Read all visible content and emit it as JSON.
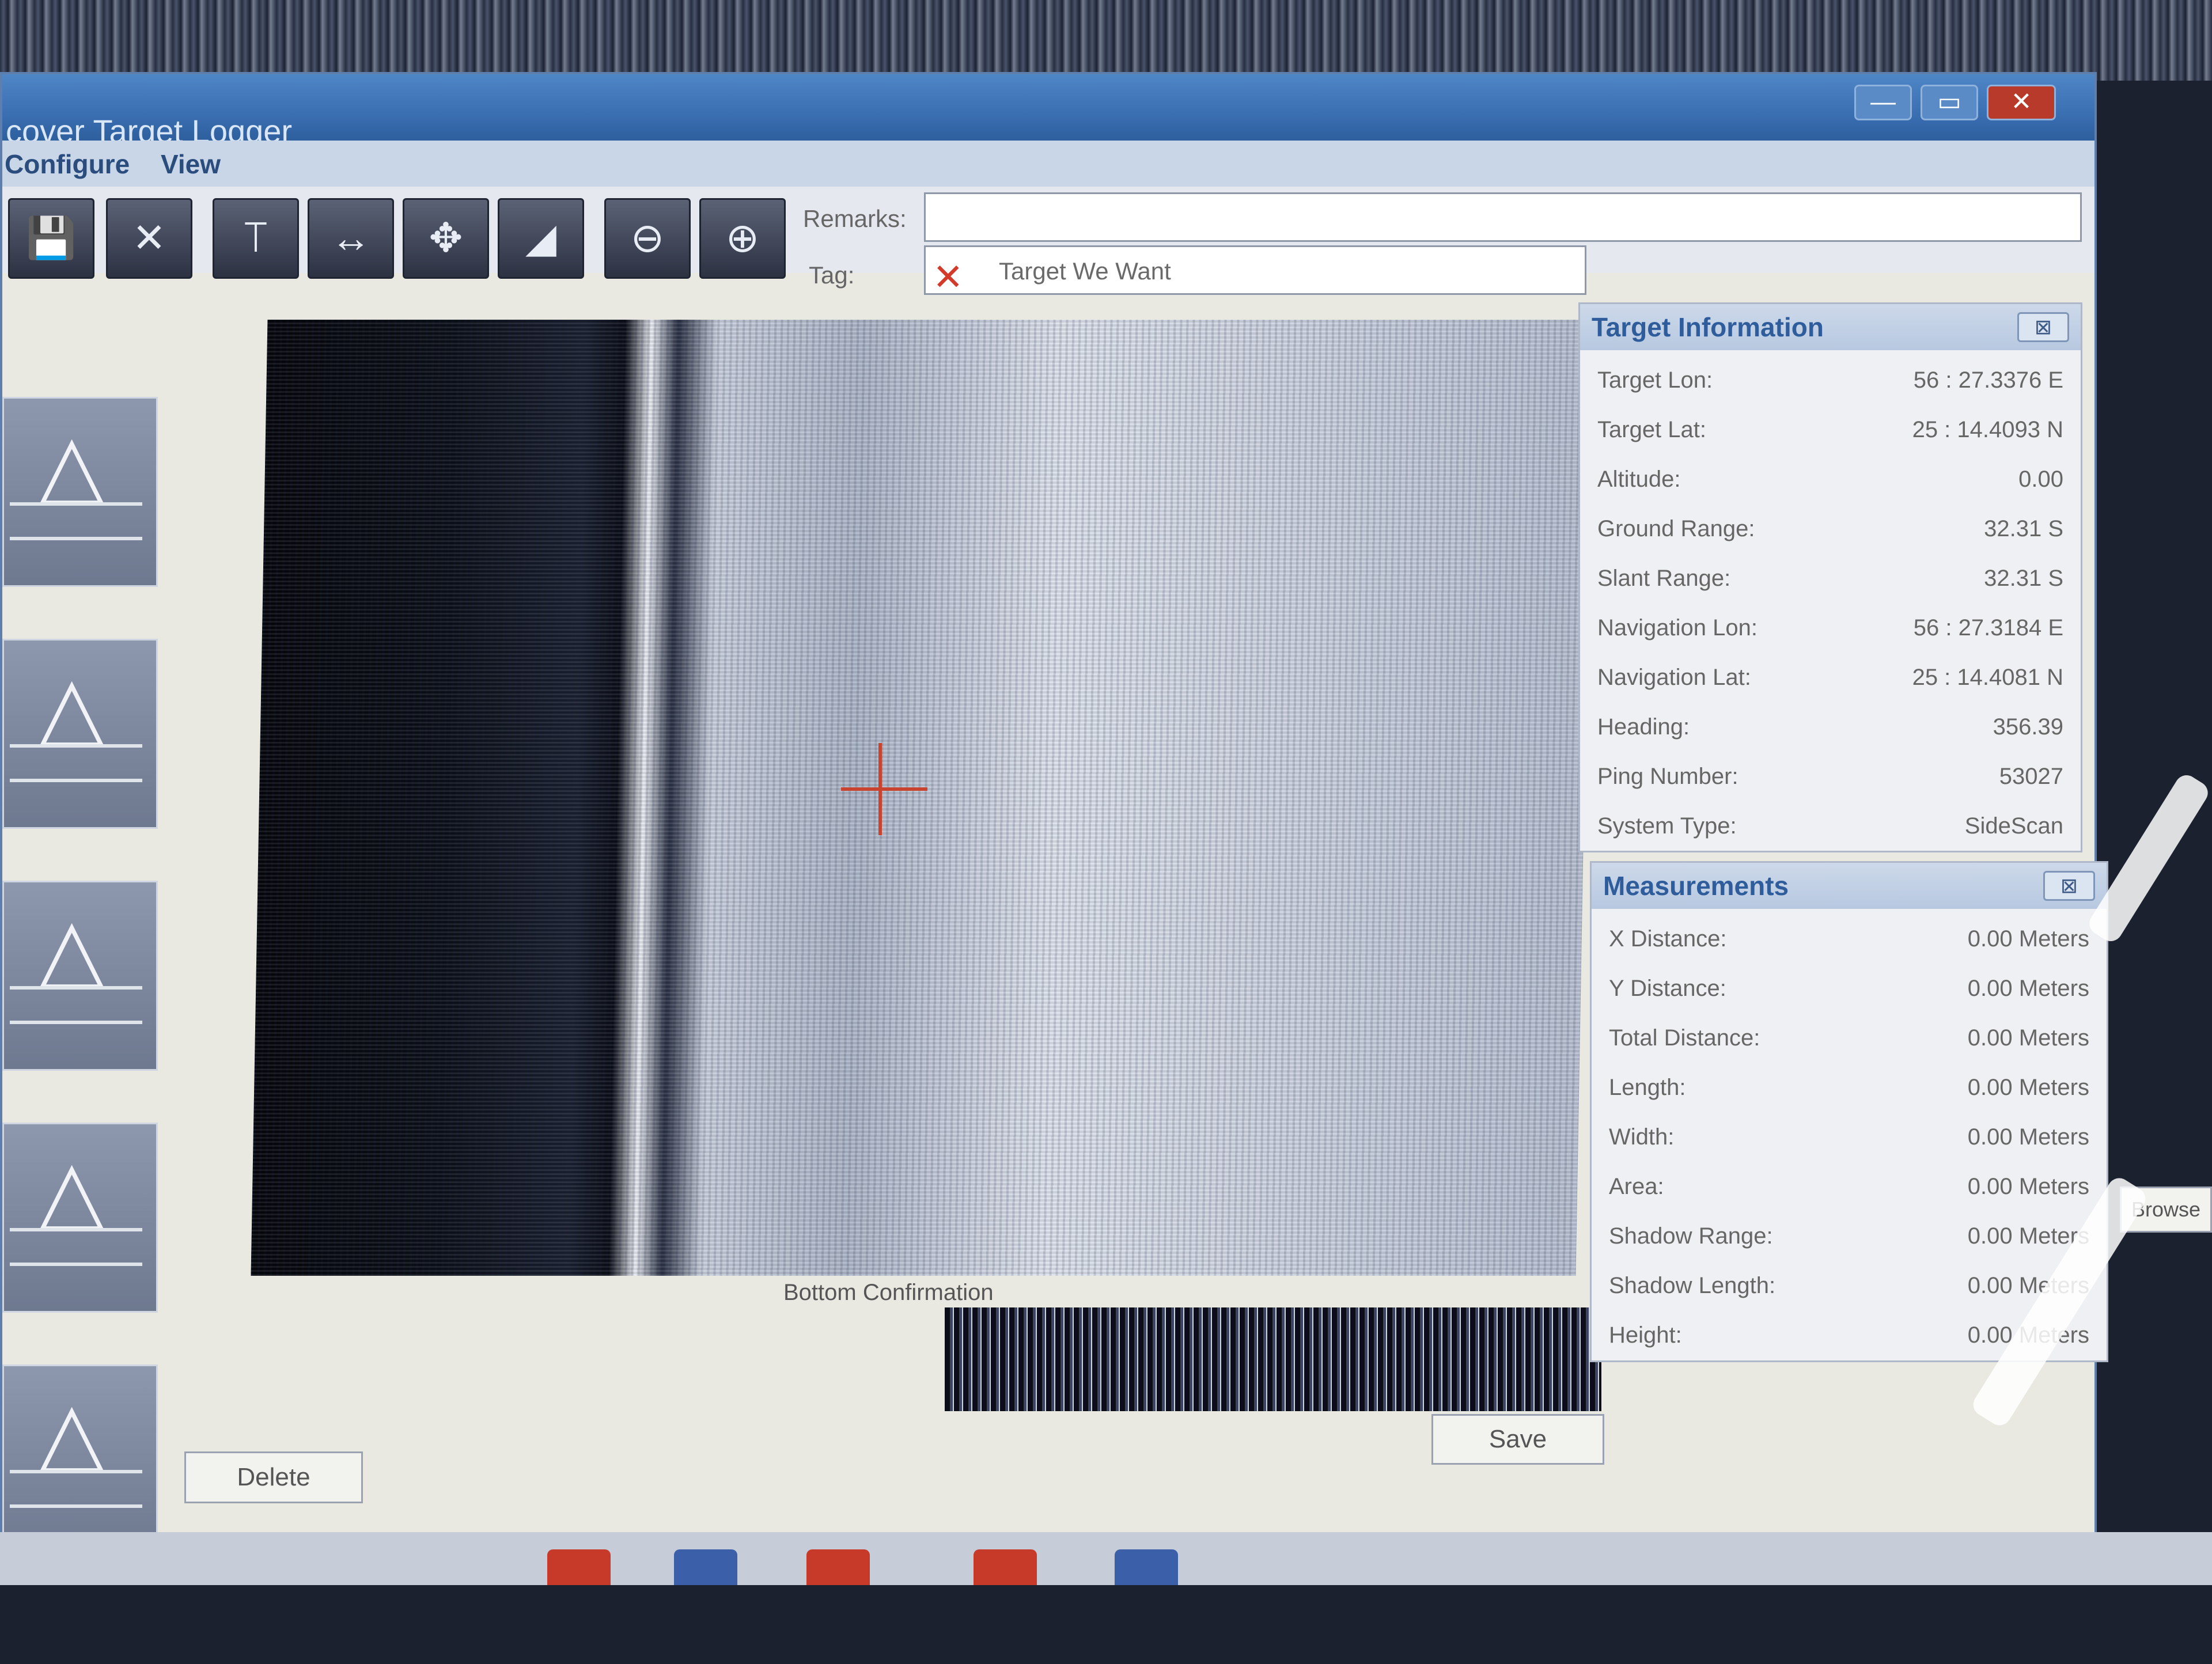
{
  "window": {
    "title": "cover Target Logger",
    "buttons": {
      "minimize": "—",
      "maximize": "▭",
      "close": "✕"
    }
  },
  "menu": [
    "Configure",
    "View"
  ],
  "toolbar": {
    "icons": [
      "save-icon",
      "delete-x-icon",
      "vertical-measure-icon",
      "horizontal-measure-icon",
      "move-icon",
      "ruler-icon",
      "zoom-out-icon",
      "zoom-in-icon"
    ],
    "remarks_label": "Remarks:",
    "remarks_value": "",
    "tag_label": "Tag:",
    "tag_value": "Target We Want"
  },
  "sonar": {
    "bottom_label": "Bottom Confirmation"
  },
  "buttons": {
    "delete": "Delete",
    "save": "Save"
  },
  "target_info": {
    "title": "Target Information",
    "rows": [
      {
        "label": "Target Lon:",
        "value": "56 : 27.3376 E"
      },
      {
        "label": "Target Lat:",
        "value": "25 : 14.4093 N"
      },
      {
        "label": "Altitude:",
        "value": "0.00"
      },
      {
        "label": "Ground Range:",
        "value": "32.31 S"
      },
      {
        "label": "Slant Range:",
        "value": "32.31 S"
      },
      {
        "label": "Navigation Lon:",
        "value": "56 : 27.3184 E"
      },
      {
        "label": "Navigation Lat:",
        "value": "25 : 14.4081 N"
      },
      {
        "label": "Heading:",
        "value": "356.39"
      },
      {
        "label": "Ping Number:",
        "value": "53027"
      },
      {
        "label": "System Type:",
        "value": "SideScan"
      }
    ]
  },
  "measurements": {
    "title": "Measurements",
    "rows": [
      {
        "label": "X Distance:",
        "value": "0.00 Meters"
      },
      {
        "label": "Y Distance:",
        "value": "0.00 Meters"
      },
      {
        "label": "Total Distance:",
        "value": "0.00 Meters"
      },
      {
        "label": "Length:",
        "value": "0.00 Meters"
      },
      {
        "label": "Width:",
        "value": "0.00 Meters"
      },
      {
        "label": "Area:",
        "value": "0.00 Meters"
      },
      {
        "label": "Shadow Range:",
        "value": "0.00 Meters"
      },
      {
        "label": "Shadow Length:",
        "value": "0.00 Meters"
      },
      {
        "label": "Height:",
        "value": "0.00 Meters"
      }
    ]
  },
  "side_button": "Browse"
}
